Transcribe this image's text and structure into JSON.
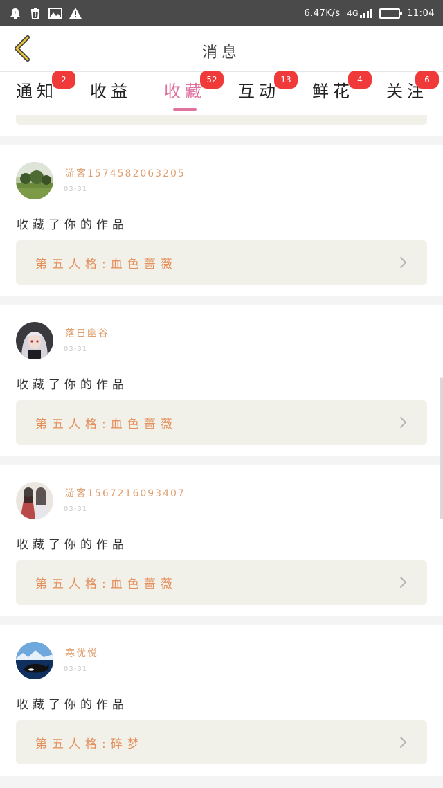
{
  "status_bar": {
    "net_speed": "6.47K/s",
    "network": "4G",
    "time": "11:04",
    "battery_fraction": 0.8
  },
  "header": {
    "title": "消息"
  },
  "tabs": [
    {
      "label": "通知",
      "badge": "2"
    },
    {
      "label": "收益",
      "badge": ""
    },
    {
      "label": "收藏",
      "badge": "52",
      "active": true
    },
    {
      "label": "互动",
      "badge": "13"
    },
    {
      "label": "鲜花",
      "badge": "4"
    },
    {
      "label": "关注",
      "badge": "6"
    }
  ],
  "messages": [
    {
      "user": "游客1574582063205",
      "date": "03-31",
      "action": "收藏了你的作品",
      "work_title": "第五人格:血色蔷薇",
      "avatar_icon": "landscape-avatar"
    },
    {
      "user": "落日幽谷",
      "date": "03-31",
      "action": "收藏了你的作品",
      "work_title": "第五人格:血色蔷薇",
      "avatar_icon": "anime-girl-avatar"
    },
    {
      "user": "游客1567216093407",
      "date": "03-31",
      "action": "收藏了你的作品",
      "work_title": "第五人格:血色蔷薇",
      "avatar_icon": "anime-couple-avatar"
    },
    {
      "user": "寒优悦",
      "date": "03-31",
      "action": "收藏了你的作品",
      "work_title": "第五人格:碎梦",
      "avatar_icon": "orca-avatar"
    }
  ],
  "colors": {
    "accent": "#e072a0",
    "badge": "#f03a3a",
    "username": "#e0a070",
    "work_title": "#e4905c",
    "back_arrow": "#e7c23a",
    "card_bg": "#f1f1ea"
  }
}
